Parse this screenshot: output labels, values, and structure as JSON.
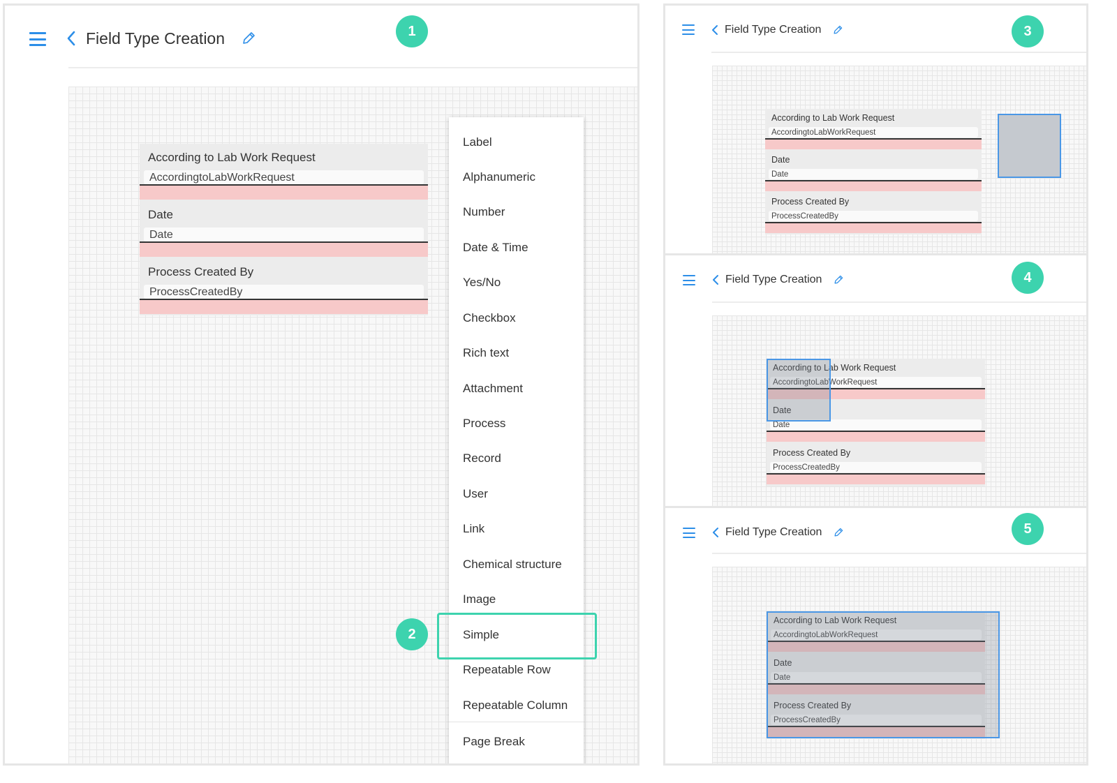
{
  "header": {
    "title": "Field Type Creation"
  },
  "badges": [
    "1",
    "2",
    "3",
    "4",
    "5"
  ],
  "form_fields": [
    {
      "label": "According to Lab Work Request",
      "value": "AccordingtoLabWorkRequest"
    },
    {
      "label": "Date",
      "value": "Date"
    },
    {
      "label": "Process Created By",
      "value": "ProcessCreatedBy"
    }
  ],
  "field_type_menu": {
    "items": [
      "Label",
      "Alphanumeric",
      "Number",
      "Date & Time",
      "Yes/No",
      "Checkbox",
      "Rich text",
      "Attachment",
      "Process",
      "Record",
      "User",
      "Link",
      "Chemical structure",
      "Image",
      "Simple",
      "Repeatable Row",
      "Repeatable Column",
      "Page Break"
    ],
    "highlighted": "Simple"
  },
  "colors": {
    "accent": "#2c8ee8",
    "badge": "#3dd3ae",
    "selection": "#4a97e6",
    "error_band": "#f7c9c9"
  },
  "icons": [
    "menu-icon",
    "chevron-left-icon",
    "pencil-icon"
  ]
}
